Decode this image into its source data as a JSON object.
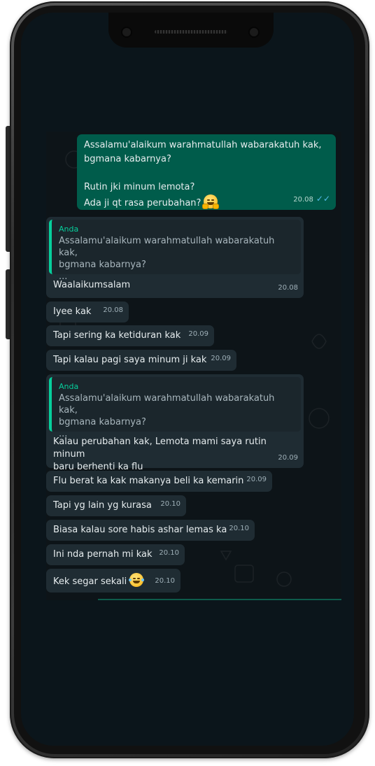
{
  "conversation": {
    "messages": [
      {
        "id": "m1",
        "direction": "outgoing",
        "text": "Assalamu'alaikum warahmatullah wabarakatuh kak,\nbgmana kabarnya?\n\nRutin jki minum lemota?\nAda ji qt rasa perubahan?",
        "emoji": "hugging-face",
        "time": "20.08",
        "status": "read"
      },
      {
        "id": "m2",
        "direction": "incoming",
        "quote": {
          "author": "Anda",
          "text": "Assalamu'alaikum warahmatullah wabarakatuh kak,\nbgmana kabarnya?\n..."
        },
        "text": "Waalaikumsalam",
        "time": "20.08"
      },
      {
        "id": "m3",
        "direction": "incoming",
        "text": "Iyee kak",
        "time": "20.08"
      },
      {
        "id": "m4",
        "direction": "incoming",
        "text": "Tapi sering ka ketiduran kak",
        "time": "20.09"
      },
      {
        "id": "m5",
        "direction": "incoming",
        "text": "Tapi kalau pagi saya minum ji kak",
        "time": "20.09"
      },
      {
        "id": "m6",
        "direction": "incoming",
        "quote": {
          "author": "Anda",
          "text": "Assalamu'alaikum warahmatullah wabarakatuh kak,\nbgmana kabarnya?\n..."
        },
        "text": "Kalau perubahan kak, Lemota mami saya rutin minum\nbaru berhenti ka flu",
        "time": "20.09"
      },
      {
        "id": "m7",
        "direction": "incoming",
        "text": "Flu berat ka kak makanya beli ka kemarin",
        "time": "20.09"
      },
      {
        "id": "m8",
        "direction": "incoming",
        "text": "Tapi yg lain yg kurasa",
        "time": "20.10"
      },
      {
        "id": "m9",
        "direction": "incoming",
        "text": "Biasa kalau sore habis ashar lemas ka",
        "time": "20.10"
      },
      {
        "id": "m10",
        "direction": "incoming",
        "text": "Ini nda pernah mi kak",
        "time": "20.10"
      },
      {
        "id": "m11",
        "direction": "incoming",
        "text": "Kek segar sekali",
        "emoji": "face-with-tears-of-joy",
        "time": "20.10"
      }
    ]
  },
  "colors": {
    "chat_background": "#0d1418",
    "incoming_bubble": "#1f2c33",
    "outgoing_bubble": "#005c4b",
    "quote_accent": "#06cf9c",
    "read_ticks": "#53bdeb"
  },
  "icons": {
    "read_receipt": "double-check-icon"
  }
}
